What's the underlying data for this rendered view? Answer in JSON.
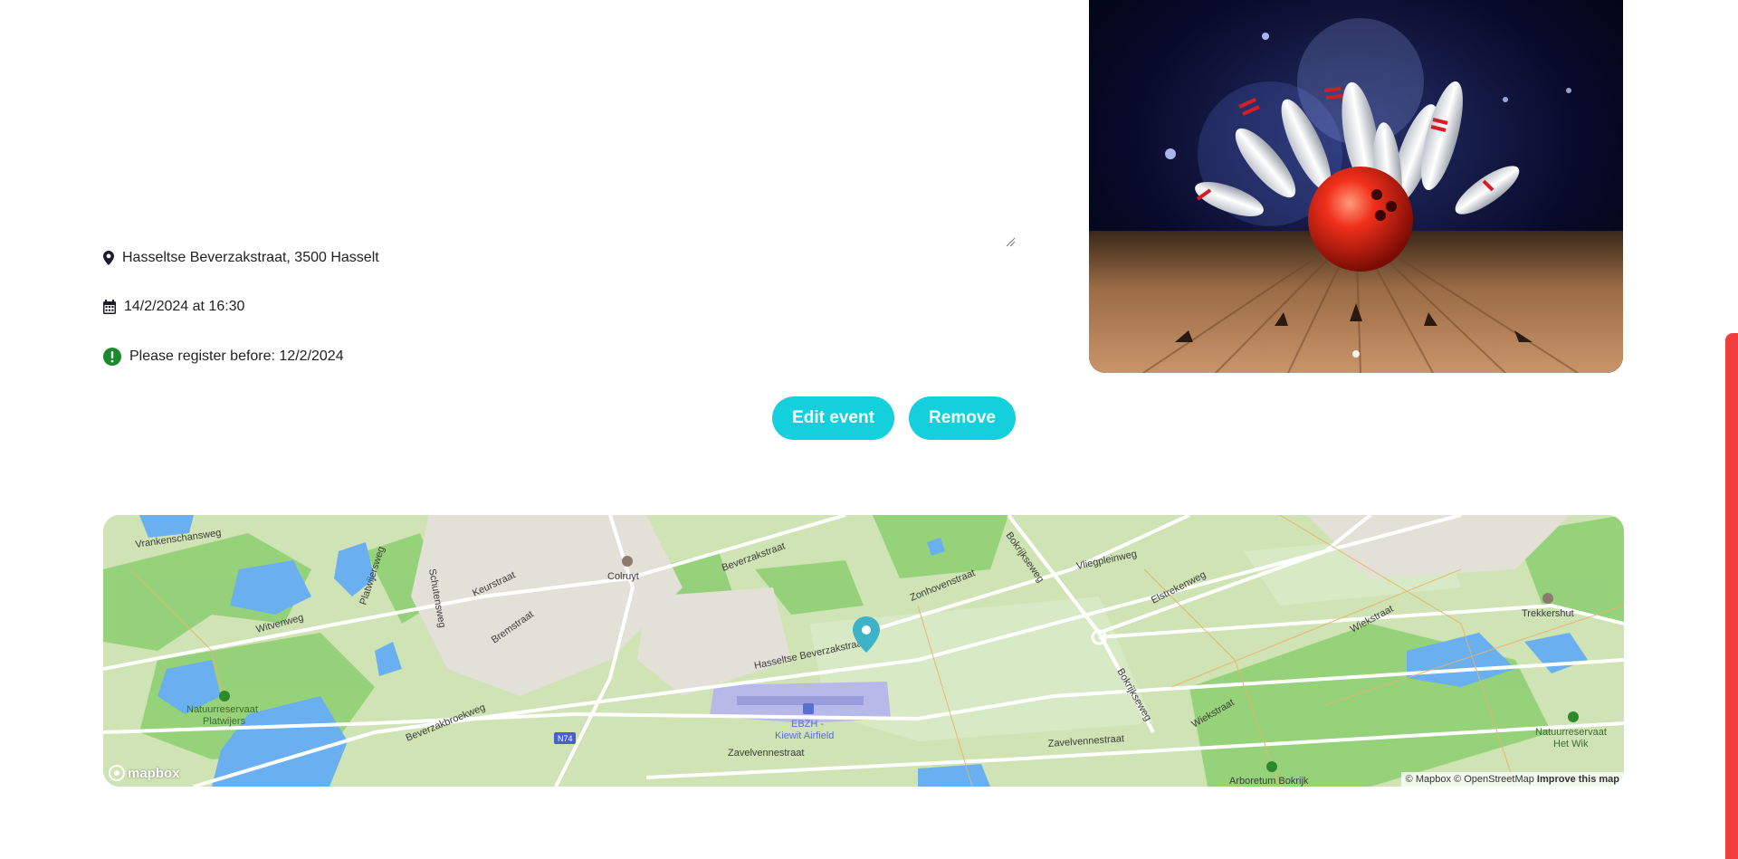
{
  "event": {
    "location": "Hasseltse Beverzakstraat, 3500 Hasselt",
    "datetime": "14/2/2024 at 16:30",
    "deadline": "Please register before: 12/2/2024"
  },
  "actions": {
    "edit_label": "Edit event",
    "remove_label": "Remove"
  },
  "carousel": {
    "slide_count": 1,
    "active_slide": 1
  },
  "map": {
    "labels": {
      "vrankenschansweg": "Vrankenschansweg",
      "platwijersweg": "Platwijersweg",
      "schutensweg": "Schutensweg",
      "keurstraat": "Keurstraat",
      "witvenweg": "Witvenweg",
      "bremstraat": "Bremstraat",
      "colruyt": "Colruyt",
      "beverzakstraat": "Beverzakstraat",
      "zonhovenstraat": "Zonhovenstraat",
      "bokrijkseweg_top": "Bokrijkseweg",
      "vliegpleinweg": "Vliegpleinweg",
      "elstrekenweg": "Elstrekenweg",
      "wiekstraat_right": "Wiekstraat",
      "trekkershut": "Trekkershut",
      "hasseltse_beverzakstraat": "Hasseltse Beverzakstraat",
      "bokrijkseweg_bottom": "Bokrijkseweg",
      "wiekstraat_bottom": "Wiekstraat",
      "natuurreservaat_platwijers_1": "Natuurreservaat",
      "natuurreservaat_platwijers_2": "Platwijers",
      "beverzakbroekweg": "Beverzakbroekweg",
      "n74": "N74",
      "ebzh": "EBZH -",
      "kiewit_airfield": "Kiewit Airfield",
      "zavelvennestraat_left": "Zavelvennestraat",
      "zavelvennestraat_right": "Zavelvennestraat",
      "natuurreservaat_hetwik_1": "Natuurreservaat",
      "natuurreservaat_hetwik_2": "Het Wik",
      "arboretum_bokrijk": "Arboretum Bokrijk"
    },
    "attribution": {
      "mapbox": "© Mapbox",
      "osm": "© OpenStreetMap",
      "improve": "Improve this map"
    },
    "logo_text": "mapbox"
  },
  "colors": {
    "accent": "#13d0dc",
    "scrollbar": "#f23d3d",
    "deadline_ok": "#1a8a2a"
  },
  "icons": [
    "location-pin-icon",
    "calendar-icon",
    "exclamation-circle-icon",
    "map-marker-icon",
    "mapbox-logo-icon"
  ]
}
